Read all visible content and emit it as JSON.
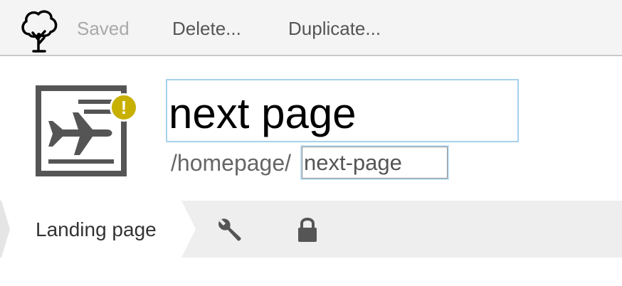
{
  "toolbar": {
    "logo_icon": "tree-icon",
    "saved_label": "Saved",
    "delete_label": "Delete...",
    "duplicate_label": "Duplicate..."
  },
  "node": {
    "icon": "landing-page-airplane-icon",
    "warning_badge": "!",
    "title": "next page",
    "url_prefix": "/homepage/",
    "slug": "next-page"
  },
  "tabs": [
    {
      "label": "Landing page",
      "active": true
    },
    {
      "icon": "wrench-icon"
    },
    {
      "icon": "lock-icon"
    }
  ],
  "colors": {
    "toolbar_bg": "#f4f4f4",
    "tabbar_bg": "#eeeeee",
    "warning": "#c7b000",
    "focus_border": "#a6d1ec",
    "icon_gray": "#555555"
  }
}
